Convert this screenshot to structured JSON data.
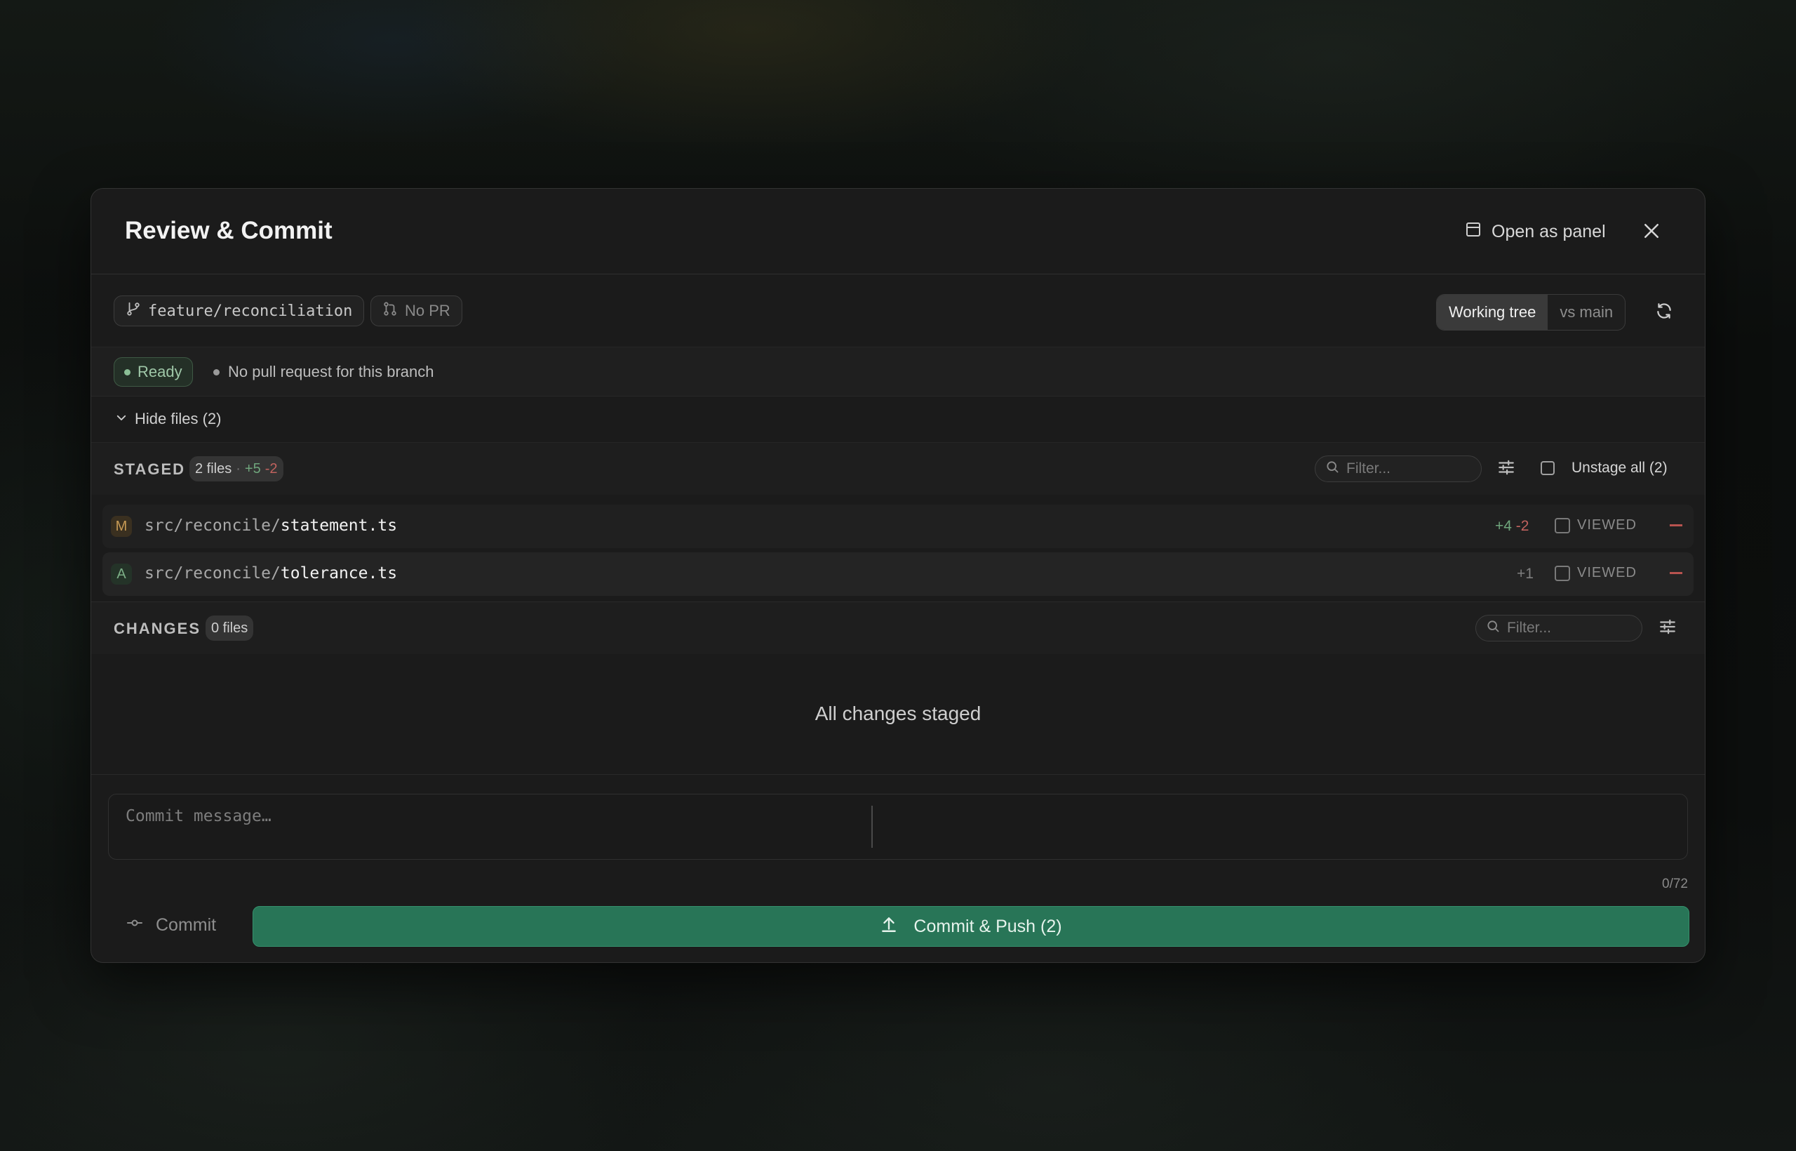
{
  "dialog": {
    "title": "Review & Commit",
    "open_as_panel_label": "Open as panel"
  },
  "branch": {
    "name": "feature/reconciliation",
    "pr_label": "No PR",
    "compare_modes": [
      "Working tree",
      "vs main"
    ],
    "active_mode": "Working tree"
  },
  "status": {
    "ready_label": "Ready",
    "note": "No pull request for this branch"
  },
  "files_toggle": {
    "label": "Hide files (2)"
  },
  "staged": {
    "label": "STAGED",
    "count_label": "2 files",
    "separator": "·",
    "additions": "+5",
    "deletions": "-2",
    "filter_placeholder": "Filter...",
    "unstage_all_label": "Unstage all (2)",
    "files": [
      {
        "status": "M",
        "dir": "src/reconcile/",
        "name": "statement.ts",
        "additions": "+4",
        "deletions": "-2",
        "viewed_label": "VIEWED"
      },
      {
        "status": "A",
        "dir": "src/reconcile/",
        "name": "tolerance.ts",
        "additions": "+1",
        "deletions": "",
        "viewed_label": "VIEWED"
      }
    ]
  },
  "changes": {
    "label": "CHANGES",
    "count_label": "0 files",
    "filter_placeholder": "Filter...",
    "empty_message": "All changes staged"
  },
  "commit": {
    "message_placeholder": "Commit message…",
    "char_count": "0/72",
    "commit_label": "Commit",
    "push_label": "Commit & Push (2)"
  },
  "colors": {
    "accent_green": "#287557",
    "addition": "#6fa57c",
    "deletion": "#c0625e",
    "modified": "#c79a55"
  },
  "icons": [
    "panel-icon",
    "close-icon",
    "branch-icon",
    "pull-request-icon",
    "refresh-icon",
    "chevron-down-icon",
    "search-icon",
    "sliders-icon",
    "commit-icon",
    "upload-icon"
  ]
}
